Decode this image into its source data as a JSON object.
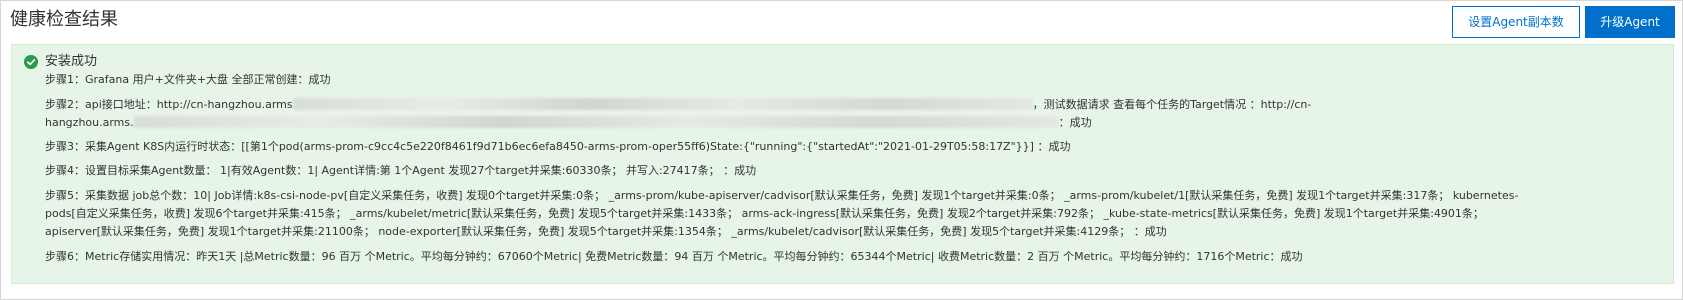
{
  "header": {
    "title": "健康检查结果",
    "set_replicas_label": "设置Agent副本数",
    "upgrade_label": "升级Agent"
  },
  "result": {
    "status_title": "安装成功",
    "status_color": "#2a9b48",
    "steps": {
      "s1": "步骤1：Grafana 用户+文件夹+大盘 全部正常创建：成功",
      "s2_prefix": "步骤2：api接口地址：http://cn-hangzhou.arms",
      "s2_mid": "，测试数据请求 查看每个任务的Target情况 ：http://cn-",
      "s2_line2_prefix": "hangzhou.arms.",
      "s2_suffix": "：成功",
      "s3": "步骤3：采集Agent K8S内运行时状态：[[第1个pod(arms-prom-c9cc4c5e220f8461f9d71b6ec6efa8450-arms-prom-oper55ff6)State:{\"running\":{\"startedAt\":\"2021-01-29T05:58:17Z\"}}] ：成功",
      "s4": "步骤4：设置目标采集Agent数量： 1|有效Agent数：1| Agent详情:第 1个Agent 发现27个target并采集:60330条； 并写入:27417条； ：成功",
      "s5": "步骤5：采集数据 job总个数：10| Job详情:k8s-csi-node-pv[自定义采集任务，收费] 发现0个target并采集:0条； _arms-prom/kube-apiserver/cadvisor[默认采集任务，免费] 发现1个target并采集:0条； _arms-prom/kubelet/1[默认采集任务，免费] 发现1个target并采集:317条； kubernetes-pods[自定义采集任务，收费] 发现6个target并采集:415条； _arms/kubelet/metric[默认采集任务，免费] 发现5个target并采集:1433条； arms-ack-ingress[默认采集任务，免费] 发现2个target并采集:792条； _kube-state-metrics[默认采集任务，免费] 发现1个target并采集:4901条； apiserver[默认采集任务，免费] 发现1个target并采集:21100条； node-exporter[默认采集任务，免费] 发现5个target并采集:1354条； _arms/kubelet/cadvisor[默认采集任务，免费] 发现5个target并采集:4129条； ：成功",
      "s6": "步骤6：Metric存储实用情况：昨天1天 |总Metric数量：96 百万 个Metric。平均每分钟约：67060个Metric| 免费Metric数量：94 百万 个Metric。平均每分钟约：65344个Metric| 收费Metric数量：2 百万 个Metric。平均每分钟约：1716个Metric：成功"
    }
  },
  "colors": {
    "primary": "#0070cc",
    "panel_bg": "#e6f5e8",
    "success": "#2a9b48"
  }
}
